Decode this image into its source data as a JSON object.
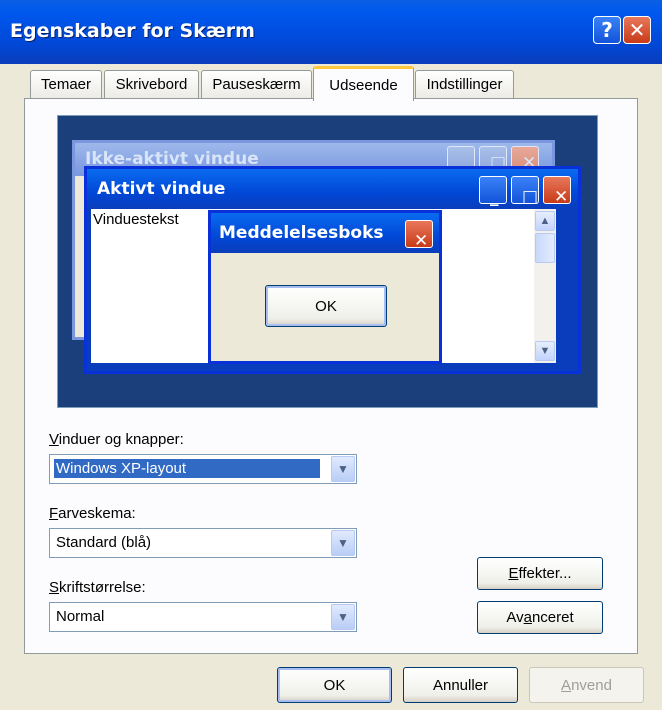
{
  "window": {
    "title": "Egenskaber for Skærm",
    "help_glyph": "?",
    "close_glyph": "✕"
  },
  "tabs": [
    {
      "label": "Temaer"
    },
    {
      "label": "Skrivebord"
    },
    {
      "label": "Pauseskærm"
    },
    {
      "label": "Udseende"
    },
    {
      "label": "Indstillinger"
    }
  ],
  "preview": {
    "inactive_title": "Ikke-aktivt vindue",
    "active_title": "Aktivt vindue",
    "window_text": "Vinduestekst",
    "message_title": "Meddelelsesboks",
    "message_ok": "OK"
  },
  "fields": {
    "windows_buttons": {
      "label_pre": "V",
      "label_rest": "induer og knapper:",
      "value": "Windows XP-layout"
    },
    "color_scheme": {
      "label_pre": "F",
      "label_rest": "arveskema:",
      "value": "Standard (blå)"
    },
    "font_size": {
      "label_pre": "S",
      "label_rest": "kriftstørrelse:",
      "value": "Normal"
    }
  },
  "buttons": {
    "effects": {
      "pre": "E",
      "rest": "ffekter..."
    },
    "advanced": {
      "pre": "Av",
      "mid": "a",
      "rest": "nceret"
    },
    "ok": "OK",
    "cancel": "Annuller",
    "apply": {
      "pre": "A",
      "rest": "nvend"
    }
  },
  "glyphs": {
    "minimize": "_",
    "maximize": "□",
    "close": "✕",
    "arrow_up": "▲",
    "arrow_down": "▼",
    "combo_arrow": "▼"
  },
  "colors": {
    "titlebar": "#0058EE",
    "selection": "#316AC5",
    "close_red": "#C83B18",
    "tab_highlight": "#FFC83C"
  }
}
